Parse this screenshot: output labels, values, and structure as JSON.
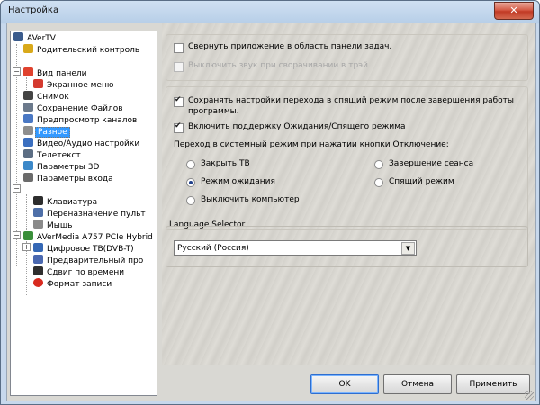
{
  "window": {
    "title": "Настройка",
    "close_symbol": "✕"
  },
  "tree": {
    "items": [
      {
        "label": "AVerTV",
        "icon": "avertv-app-icon",
        "color": "#3a5b8c"
      },
      {
        "label": "Родительский контроль",
        "icon": "lock-icon",
        "color": "#d9a91a"
      },
      {
        "label": "Вид панели",
        "icon": "panel-view-icon",
        "color": "#e0422e"
      },
      {
        "label": "Экранное меню",
        "icon": "osd-menu-icon",
        "color": "#d43a2f"
      },
      {
        "label": "Снимок",
        "icon": "camera-icon",
        "color": "#444444"
      },
      {
        "label": "Сохранение Файлов",
        "icon": "save-files-icon",
        "color": "#6c7a8c"
      },
      {
        "label": "Предпросмотр каналов",
        "icon": "preview-channels-icon",
        "color": "#4a78c4"
      },
      {
        "label": "Разное",
        "icon": "misc-icon",
        "color": "#8e8e8e"
      },
      {
        "label": "Видео/Аудио настройки",
        "icon": "tools-icon",
        "color": "#3b6fc0"
      },
      {
        "label": "Телетекст",
        "icon": "teletext-icon",
        "color": "#5c6e84"
      },
      {
        "label": "Параметры 3D",
        "icon": "gear-3d-icon",
        "color": "#3b88c9"
      },
      {
        "label": "Параметры входа",
        "icon": "input-params-icon",
        "color": "#6b6b6b"
      },
      {
        "label": "Клавиатура",
        "icon": "keyboard-icon",
        "color": "#2d2d2d"
      },
      {
        "label": "Переназначение пульт",
        "icon": "remote-remap-icon",
        "color": "#4e6fa8"
      },
      {
        "label": "Мышь",
        "icon": "mouse-icon",
        "color": "#8a8a8a"
      },
      {
        "label": "AVerMedia A757 PCIe Hybrid",
        "icon": "tuner-card-icon",
        "color": "#3a8f3a"
      },
      {
        "label": "Цифровое ТВ(DVB-T)",
        "icon": "digital-tv-icon",
        "color": "#3568b5"
      },
      {
        "label": "Предварительный про",
        "icon": "preview-icon",
        "color": "#4a68b0"
      },
      {
        "label": "Сдвиг по времени",
        "icon": "timeshift-icon",
        "color": "#2f2f2f"
      },
      {
        "label": "Формат записи",
        "icon": "record-icon",
        "color": "#d82a1f"
      }
    ],
    "selected_label": "Разное"
  },
  "options": {
    "minimize_to_tray": {
      "label": "Свернуть приложение в область панели задач.",
      "checked": false
    },
    "mute_when_minimized": {
      "label": "Выключить звук при сворачивании в трэй",
      "checked": false,
      "disabled": true
    },
    "save_transition_settings": {
      "label_line1": "Сохранять настройки перехода в спящий режим после завершения работы",
      "label_line2": "программы.",
      "checked": true
    },
    "enable_standby": {
      "label": "Включить поддержку Ожидания/Спящего режима",
      "checked": true
    },
    "system_mode_heading": "Переход в системный режим при нажатии кнопки Отключение:",
    "radios": {
      "close_tv": {
        "label": "Закрыть ТВ",
        "checked": false
      },
      "standby": {
        "label": "Режим ожидания",
        "checked": true
      },
      "shutdown_computer": {
        "label": "Выключить компьютер",
        "checked": false
      },
      "end_session": {
        "label": "Завершение сеанса",
        "checked": false
      },
      "sleep_mode": {
        "label": "Спящий режим",
        "checked": false
      }
    }
  },
  "language": {
    "group_title": "Language Selector",
    "selected": "Русский (Россия)",
    "arrow": "▼"
  },
  "buttons": {
    "ok": "OK",
    "cancel": "Отмена",
    "apply": "Применить"
  },
  "tree_expanders": {
    "expanded": "−",
    "collapsed": "+"
  }
}
